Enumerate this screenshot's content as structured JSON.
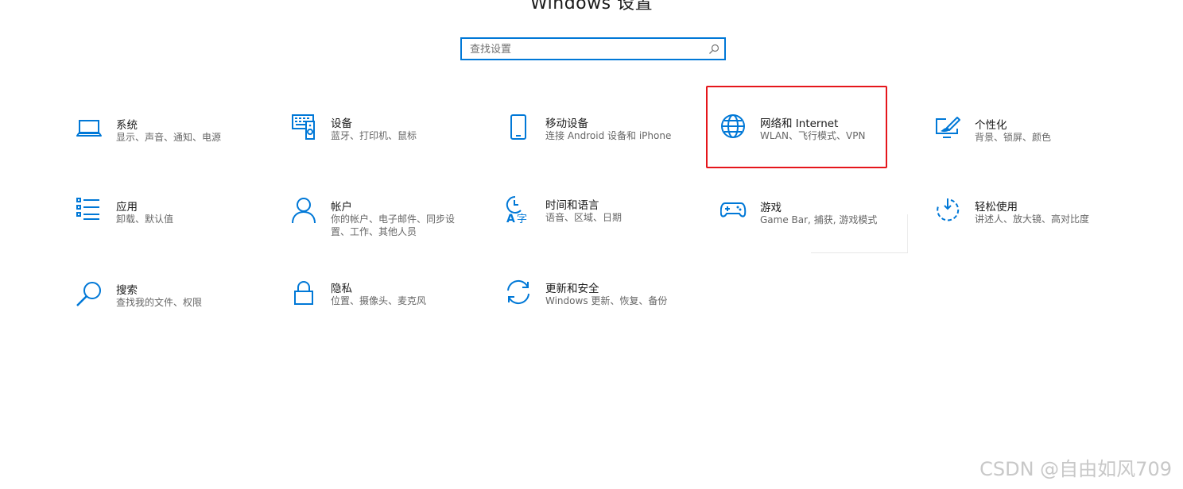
{
  "window": {
    "title": "Windows 设置"
  },
  "search": {
    "placeholder": "查找设置",
    "value": ""
  },
  "tiles": [
    {
      "icon": "laptop-icon",
      "title": "系统",
      "desc": "显示、声音、通知、电源"
    },
    {
      "icon": "keyboard-speaker-icon",
      "title": "设备",
      "desc": "蓝牙、打印机、鼠标"
    },
    {
      "icon": "phone-icon",
      "title": "移动设备",
      "desc": "连接 Android 设备和 iPhone"
    },
    {
      "icon": "globe-icon",
      "title": "网络和 Internet",
      "desc": "WLAN、飞行模式、VPN"
    },
    {
      "icon": "paint-brush-icon",
      "title": "个性化",
      "desc": "背景、锁屏、颜色"
    },
    {
      "icon": "apps-list-icon",
      "title": "应用",
      "desc": "卸载、默认值"
    },
    {
      "icon": "person-icon",
      "title": "帐户",
      "desc": "你的帐户、电子邮件、同步设置、工作、其他人员"
    },
    {
      "icon": "time-language-icon",
      "title": "时间和语言",
      "desc": "语音、区域、日期"
    },
    {
      "icon": "gamepad-icon",
      "title": "游戏",
      "desc": "Game Bar, 捕获, 游戏模式"
    },
    {
      "icon": "ease-of-access-icon",
      "title": "轻松使用",
      "desc": "讲述人、放大镜、高对比度"
    },
    {
      "icon": "search-icon",
      "title": "搜索",
      "desc": "查找我的文件、权限"
    },
    {
      "icon": "lock-icon",
      "title": "隐私",
      "desc": "位置、摄像头、麦克风"
    },
    {
      "icon": "sync-arrows-icon",
      "title": "更新和安全",
      "desc": "Windows 更新、恢复、备份"
    }
  ],
  "highlighted_tile": "网络和 Internet",
  "colors": {
    "accent": "#0078d7",
    "highlight_box": "#e5161b"
  },
  "watermark": "CSDN @自由如风709"
}
